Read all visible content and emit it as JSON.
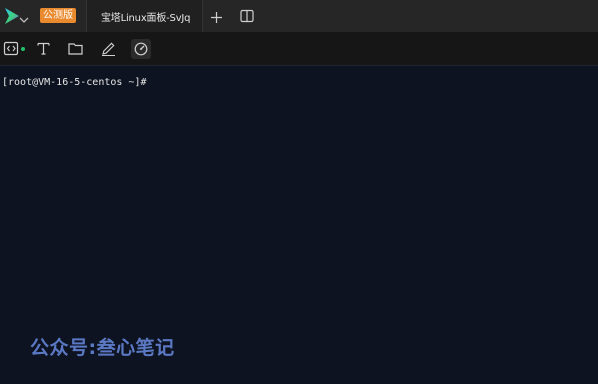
{
  "titlebar": {
    "badge": "公测版",
    "active_tab": "宝塔Linux面板-SvJq",
    "icons": [
      "app-logo-icon",
      "chevron-down-icon",
      "plus-icon",
      "split-view-icon"
    ]
  },
  "toolbar": {
    "icons": [
      "code-icon",
      "text-icon",
      "folder-icon",
      "edit-icon",
      "gauge-icon"
    ],
    "status_color": "#24c06a"
  },
  "terminal": {
    "prompt": "[root@VM-16-5-centos ~]#"
  },
  "watermark": "公众号:叁心笔记",
  "colors": {
    "badge": "#e98a2e",
    "terminal_bg": "#0d1320",
    "watermark": "#5b78c4"
  }
}
